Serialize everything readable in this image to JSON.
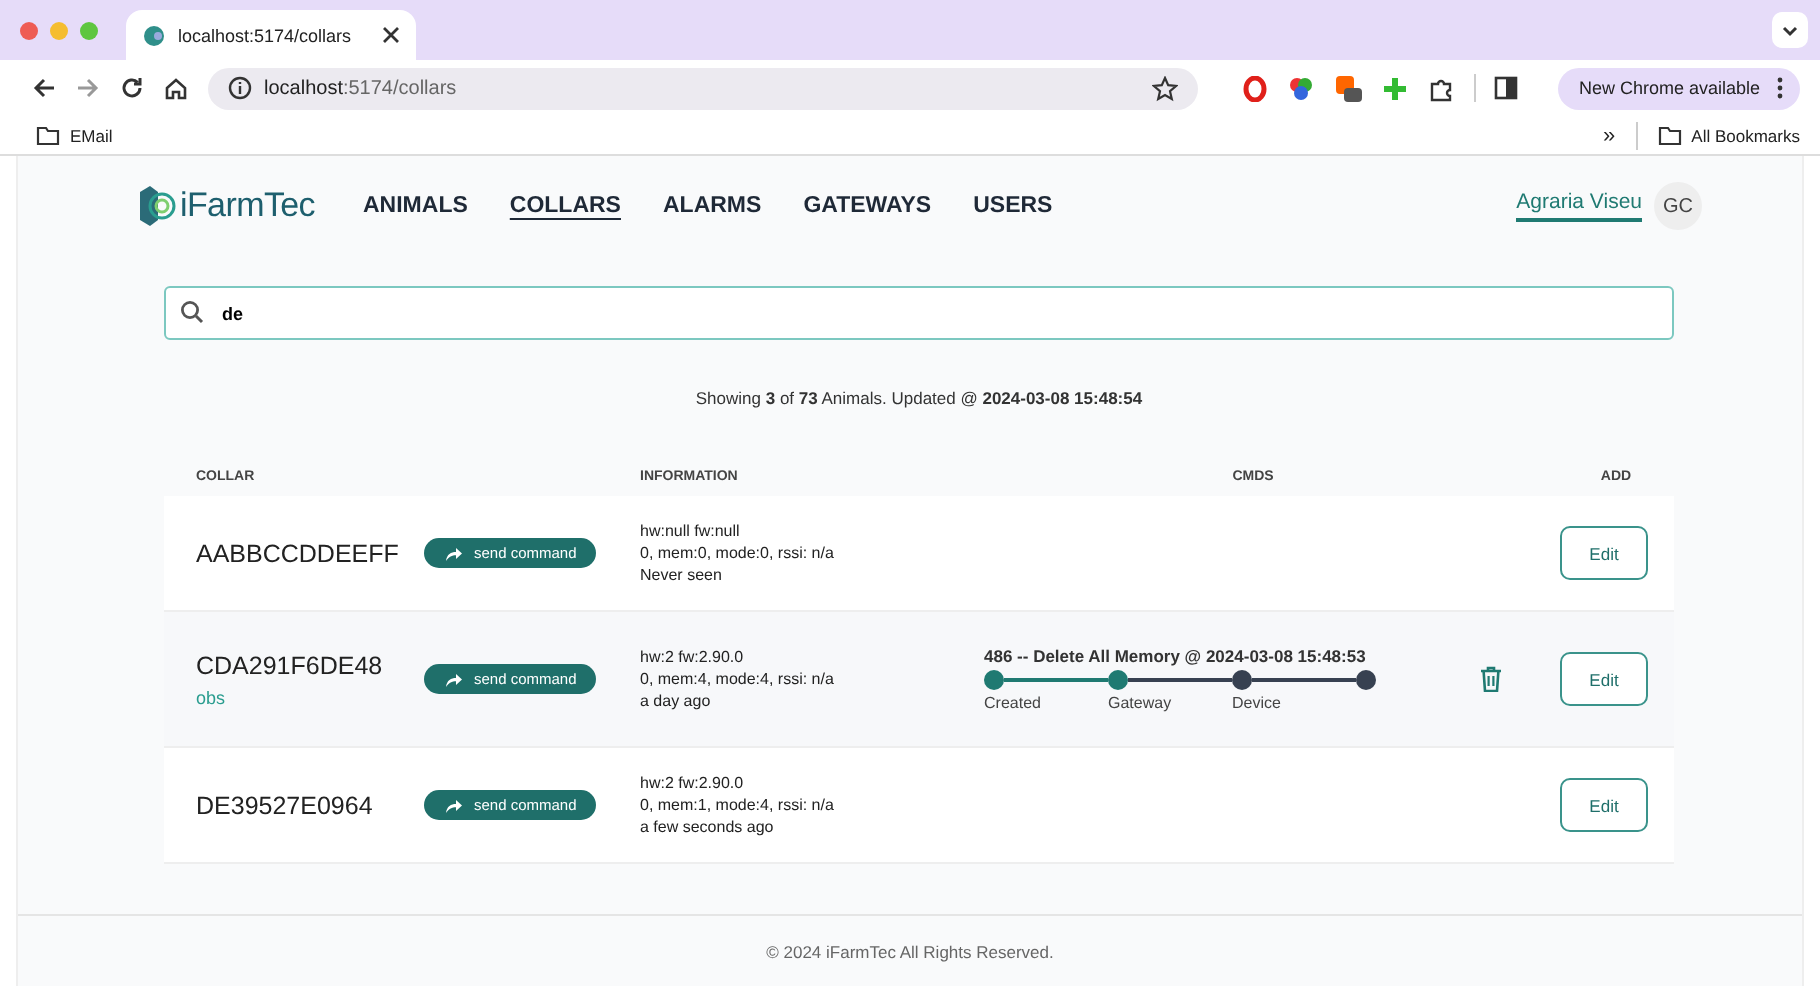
{
  "browser": {
    "tab_title": "localhost:5174/collars",
    "url_host": "localhost",
    "url_path": ":5174/collars",
    "update_button": "New Chrome available",
    "bookmarks": [
      {
        "label": "EMail"
      }
    ],
    "all_bookmarks": "All Bookmarks",
    "overflow": "»"
  },
  "nav": {
    "logo": "iFarmTec",
    "items": [
      {
        "label": "ANIMALS",
        "selected": false
      },
      {
        "label": "COLLARS",
        "selected": true
      },
      {
        "label": "ALARMS",
        "selected": false
      },
      {
        "label": "GATEWAYS",
        "selected": false
      },
      {
        "label": "USERS",
        "selected": false
      }
    ],
    "org": "Agraria Viseu",
    "avatar": "GC"
  },
  "search": {
    "value": "de"
  },
  "summary": "Showing **3** of **73** Animals. Updated @ **2024-03-08 15:48:54**",
  "table": {
    "columns": [
      "COLLAR",
      "INFORMATION",
      "CMDS",
      "ADD"
    ],
    "rows": [
      {
        "collar": "AABBCCDDEEFF",
        "send": "send command",
        "info": [
          "hw:null fw:null",
          "0, mem:0, mode:0, rssi: n/a",
          "Never seen"
        ],
        "edit": "Edit"
      },
      {
        "collar": "CDA291F6DE48",
        "note": "obs",
        "send": "send command",
        "info": [
          "hw:2 fw:2.90.0",
          "0, mem:4, mode:4, rssi: n/a",
          "a day ago"
        ],
        "command": {
          "title": "486 -- Delete All Memory @ 2024-03-08 15:48:53",
          "steps": [
            {
              "label": "Created",
              "done": true
            },
            {
              "label": "Gateway",
              "done": true
            },
            {
              "label": "Device",
              "done": false
            },
            {
              "done": false
            }
          ]
        },
        "edit": "Edit"
      },
      {
        "collar": "DE39527E0964",
        "send": "send command",
        "info": [
          "hw:2 fw:2.90.0",
          "0, mem:1, mode:4, rssi: n/a",
          "a few seconds ago"
        ],
        "edit": "Edit"
      }
    ]
  },
  "footer": "© 2024 iFarmTec All Rights Reserved."
}
